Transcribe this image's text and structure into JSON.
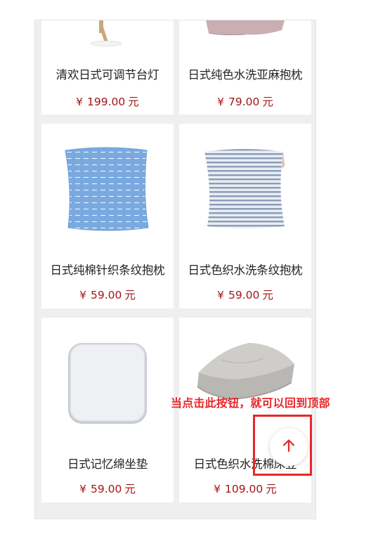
{
  "products": [
    {
      "name": "清欢日式可调节台灯",
      "currency": "¥",
      "price": "199.00",
      "unit": "元"
    },
    {
      "name": "日式纯色水洗亚麻抱枕",
      "currency": "¥",
      "price": "79.00",
      "unit": "元"
    },
    {
      "name": "日式纯棉针织条纹抱枕",
      "currency": "¥",
      "price": "59.00",
      "unit": "元"
    },
    {
      "name": "日式色织水洗条纹抱枕",
      "currency": "¥",
      "price": "59.00",
      "unit": "元"
    },
    {
      "name": "日式记忆绵坐垫",
      "currency": "¥",
      "price": "59.00",
      "unit": "元"
    },
    {
      "name": "日式色织水洗棉床笠",
      "currency": "¥",
      "price": "109.00",
      "unit": "元"
    }
  ],
  "annotation": {
    "text": "当点击此按钮，就可以回到顶部"
  },
  "back_to_top": {
    "icon": "arrow-up-icon"
  },
  "colors": {
    "price": "#a31515",
    "annotation": "#e8262a",
    "background": "#efefef"
  }
}
